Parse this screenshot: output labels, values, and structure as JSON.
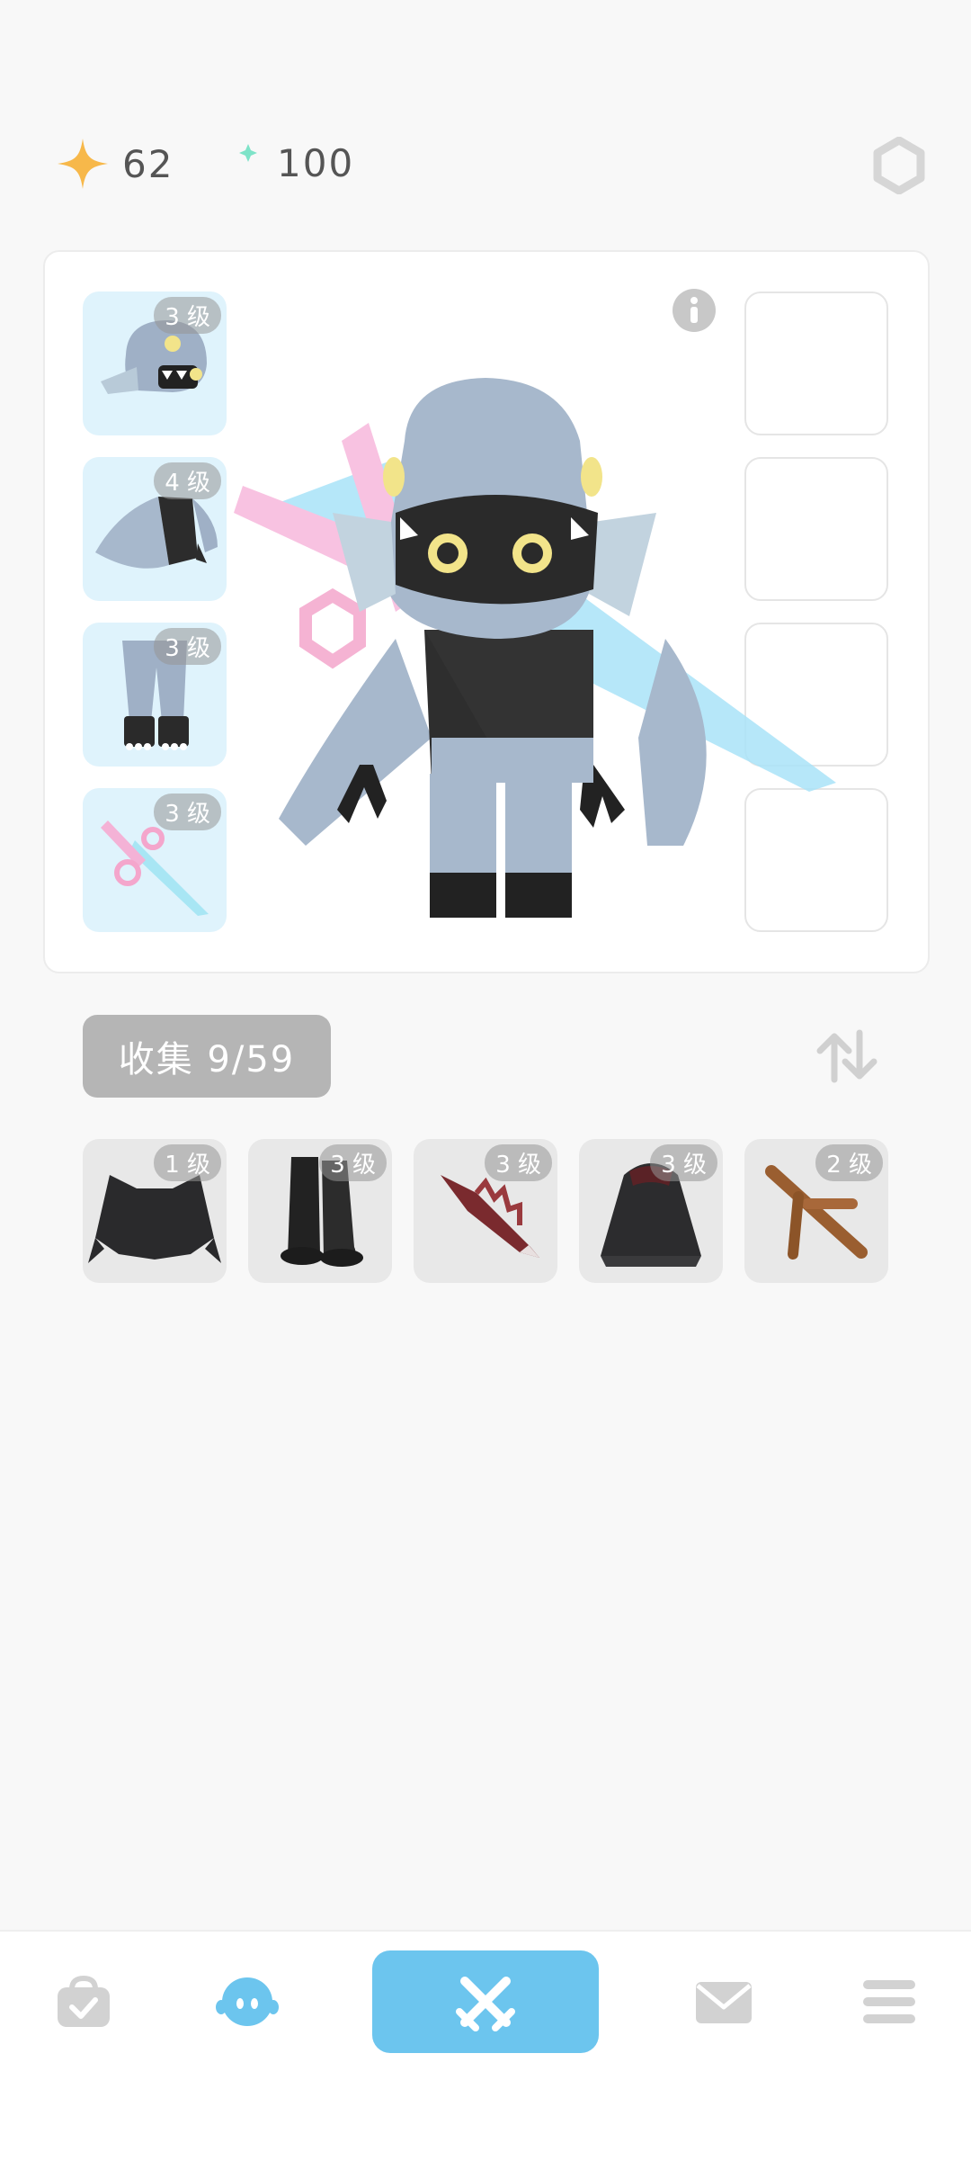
{
  "currency": {
    "stars": "62",
    "moons": "100"
  },
  "equipped": {
    "left_slots": [
      {
        "level": "3 级",
        "item": "helmet"
      },
      {
        "level": "4 级",
        "item": "armor"
      },
      {
        "level": "3 级",
        "item": "pants"
      },
      {
        "level": "3 级",
        "item": "sword"
      }
    ],
    "right_slots_empty": 4
  },
  "collection": {
    "label": "收集 9/59",
    "items": [
      {
        "level": "1 级",
        "item": "dark-armor"
      },
      {
        "level": "3 级",
        "item": "dark-boots"
      },
      {
        "level": "3 级",
        "item": "red-blade"
      },
      {
        "level": "3 级",
        "item": "dark-hood"
      },
      {
        "level": "2 级",
        "item": "wooden-branch"
      }
    ]
  },
  "nav": {
    "items": [
      "shop-bag-icon",
      "character-icon",
      "battle-swords-icon",
      "mail-icon",
      "menu-icon"
    ],
    "active": "battle-swords-icon"
  },
  "colors": {
    "accent": "#6cc5ee",
    "slot_bg": "#dff3fc",
    "item_bg": "#e8e8e8"
  }
}
